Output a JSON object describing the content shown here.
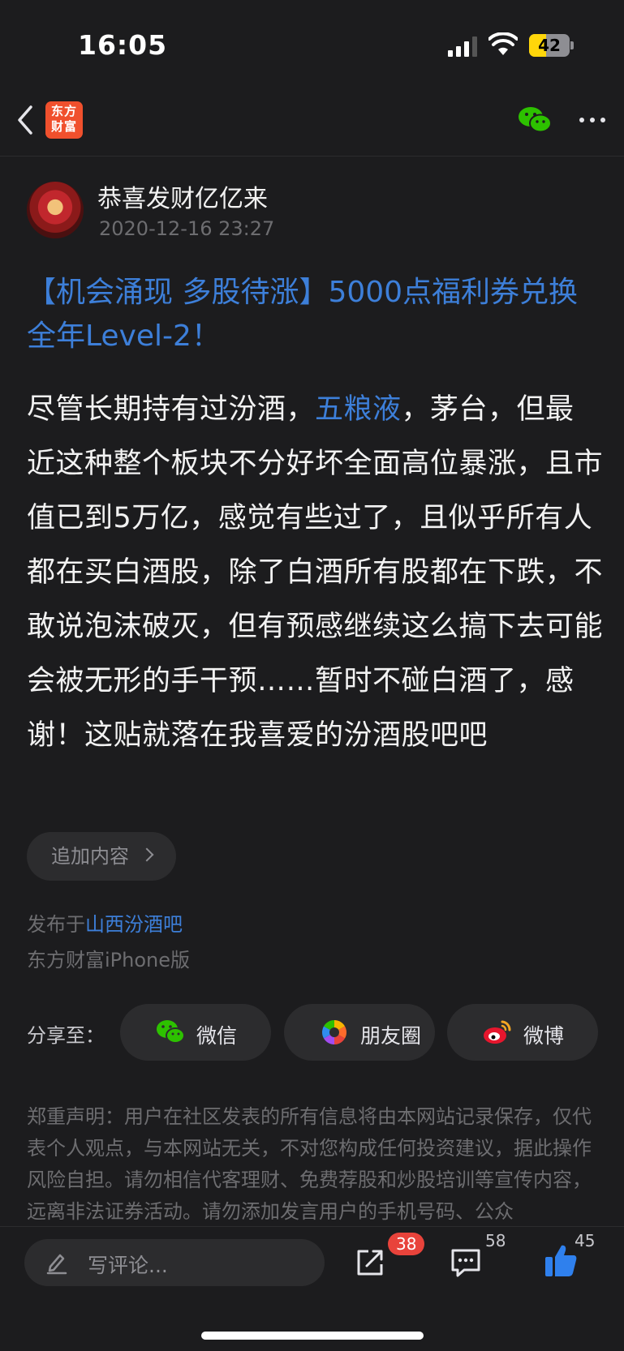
{
  "status_bar": {
    "time": "16:05",
    "battery": "42",
    "battery_level": 0.42
  },
  "nav": {
    "logo_line1": "东方",
    "logo_line2": "财富"
  },
  "post": {
    "author": "恭喜发财亿亿来",
    "date": "2020-12-16 23:27",
    "title": "【机会涌现 多股待涨】5000点福利券兑换全年Level-2！",
    "body_part1": "尽管长期持有过汾酒，",
    "body_link": "五粮液",
    "body_part2": "，茅台，但最近这种整个板块不分好坏全面高位暴涨，且市值已到5万亿，感觉有些过了，且似乎所有人都在买白酒股，除了白酒所有股都在下跌，不敢说泡沫破灭，但有预感继续这么搞下去可能会被无形的手干预……暂时不碰白酒了，感谢！这贴就落在我喜爱的汾酒股吧吧",
    "add_content": "追加内容",
    "published_prefix": "发布于",
    "published_bar": "山西汾酒吧",
    "client": "东方财富iPhone版"
  },
  "share": {
    "label": "分享至：",
    "wechat": "微信",
    "moments": "朋友圈",
    "weibo": "微博"
  },
  "disclaimer": "郑重声明：用户在社区发表的所有信息将由本网站记录保存，仅代表个人观点，与本网站无关，不对您构成任何投资建议，据此操作风险自担。请勿相信代客理财、免费荐股和炒股培训等宣传内容，远离非法证券活动。请勿添加发言用户的手机号码、公众",
  "bottom_bar": {
    "comment_placeholder": "写评论...",
    "share_count": "38",
    "comment_count": "58",
    "like_count": "45"
  },
  "colors": {
    "accent_blue": "#3d7fd9",
    "badge_red": "#e8433b",
    "logo_orange": "#f0502d",
    "wechat_green": "#2dc100"
  }
}
